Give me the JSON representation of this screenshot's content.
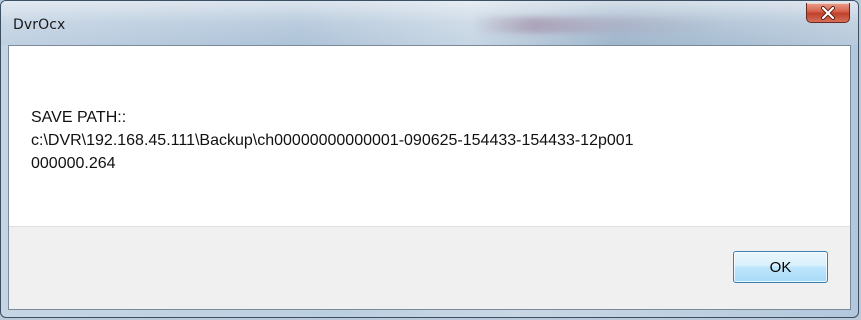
{
  "window": {
    "title": "DvrOcx"
  },
  "message": {
    "line1": "SAVE PATH::",
    "line2": "c:\\DVR\\192.168.45.111\\Backup\\ch00000000000001-090625-154433-154433-12p001",
    "line3": "000000.264"
  },
  "buttons": {
    "ok_label": "OK"
  },
  "icons": {
    "close": "close-icon"
  },
  "colors": {
    "close_button": "#c9503a",
    "ok_button_border": "#3c7fb1",
    "message_background": "#ffffff",
    "footer_background": "#f0f0f0"
  }
}
